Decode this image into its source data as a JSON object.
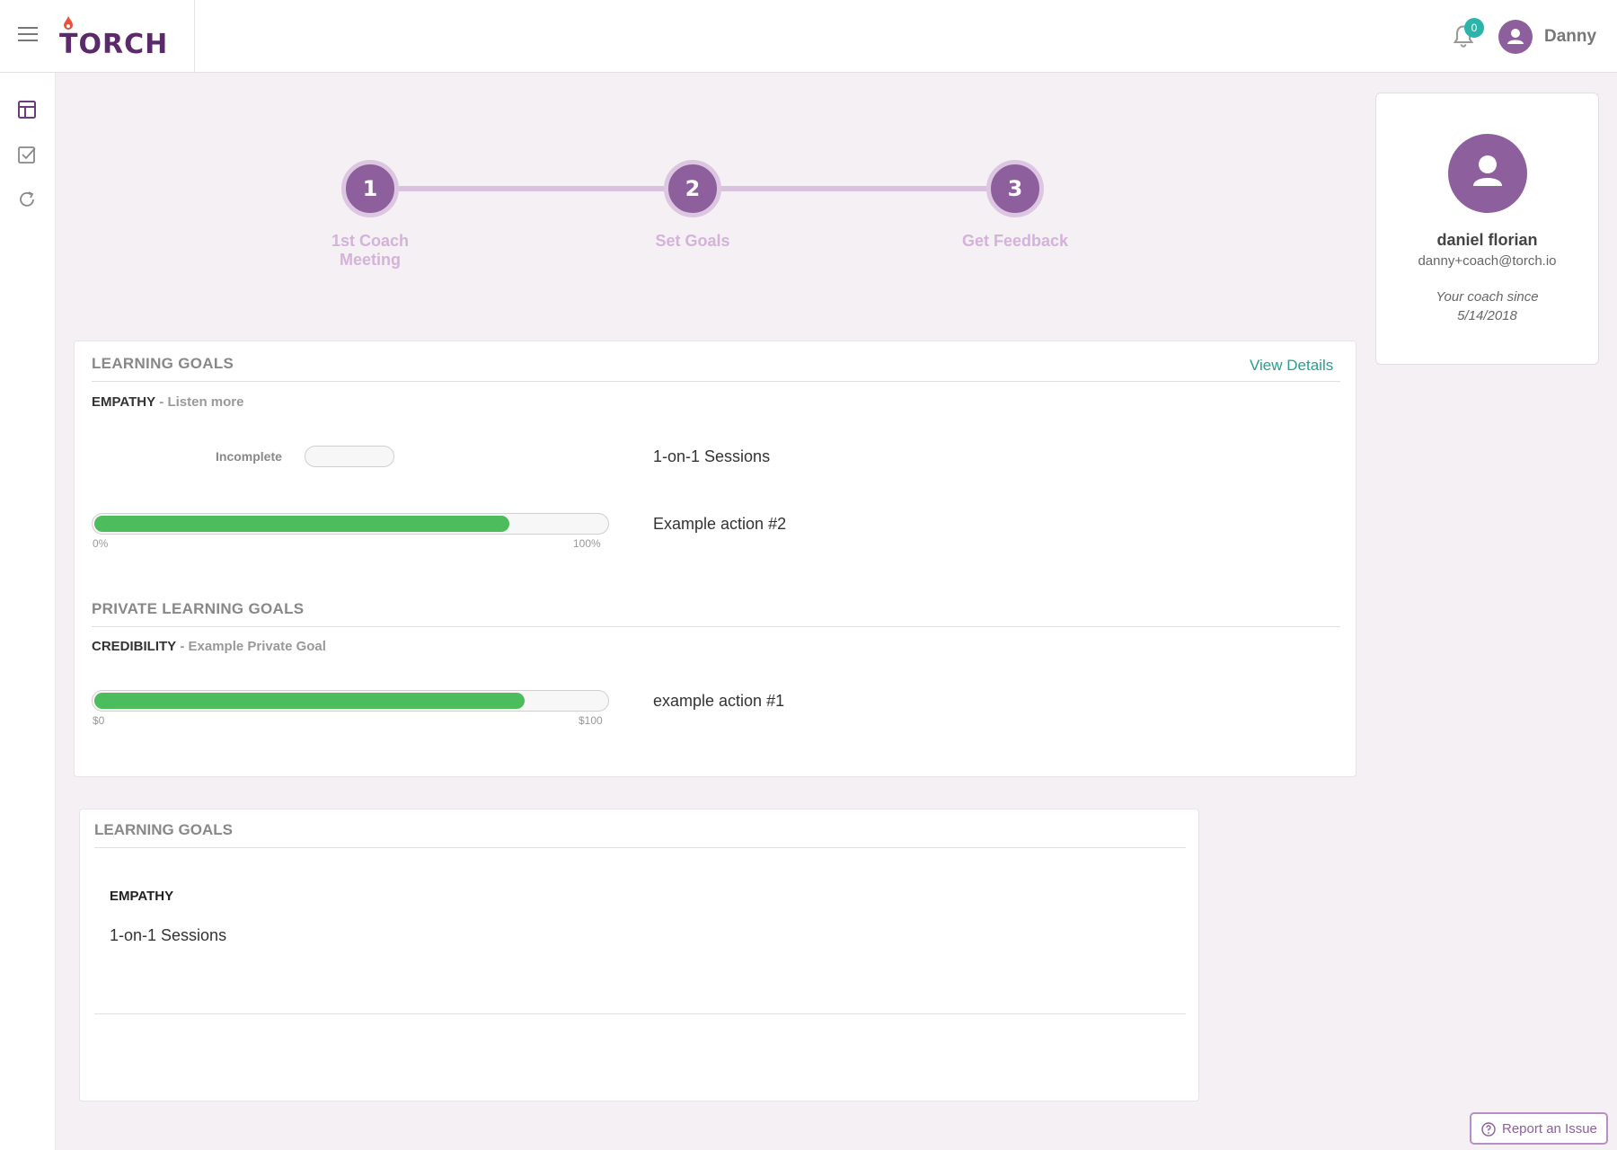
{
  "header": {
    "brand": "TORCH",
    "notification_count": "0",
    "user_name": "Danny"
  },
  "sidebar": {
    "items": [
      {
        "icon": "layout-icon"
      },
      {
        "icon": "checkbox-icon"
      },
      {
        "icon": "refresh-icon"
      }
    ]
  },
  "stepper": {
    "steps": [
      {
        "number": "1",
        "label_line1": "1st Coach",
        "label_line2": "Meeting"
      },
      {
        "number": "2",
        "label_line1": "Set Goals",
        "label_line2": ""
      },
      {
        "number": "3",
        "label_line1": "Get Feedback",
        "label_line2": ""
      }
    ]
  },
  "coach": {
    "name": "daniel florian",
    "email": "danny+coach@torch.io",
    "since_line1": "Your coach since",
    "since_line2": "5/14/2018"
  },
  "learning_goals": {
    "title": "LEARNING GOALS",
    "view_details": "View Details",
    "goal_name": "EMPATHY",
    "goal_desc": "- Listen more",
    "toggle_label": "Incomplete",
    "action1": "1-on-1 Sessions",
    "progress_action": "Example action #2",
    "progress_value": 0.81,
    "progress_min": "0%",
    "progress_max": "100%"
  },
  "private_goals": {
    "title": "PRIVATE LEARNING GOALS",
    "goal_name": "CREDIBILITY",
    "goal_desc": "- Example Private Goal",
    "progress_action": "example action #1",
    "progress_value": 0.84,
    "progress_min": "$0",
    "progress_max": "$100"
  },
  "secondary_goals": {
    "title": "LEARNING GOALS",
    "goal_name": "EMPATHY",
    "action": "1-on-1 Sessions"
  },
  "footer": {
    "report_label": "Report an Issue"
  },
  "colors": {
    "brand_purple": "#8d5f9c",
    "progress_green": "#4cbc5c",
    "link_teal": "#2a9d8f"
  }
}
